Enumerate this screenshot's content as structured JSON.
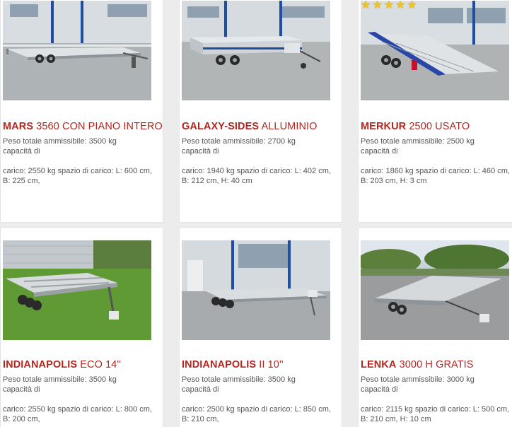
{
  "products": [
    {
      "brand": "MARS",
      "model": " 3560 CON PIANO INTERO",
      "weight_line": "Peso totale ammissibile: 3500 kg",
      "capacity_label": "capacità di",
      "cargo_line": "carico: 2550 kg spazio di carico: L: 600 cm, B: 225 cm,",
      "image_icon": "flatbed-trailer-photo"
    },
    {
      "brand": "GALAXY-SIDES",
      "model": " ALLUMINIO",
      "weight_line": "Peso totale ammissibile: 2700 kg",
      "capacity_label": "capacità di",
      "cargo_line": "carico: 1940 kg spazio di carico: L: 402 cm, B: 212 cm, H: 40 cm",
      "image_icon": "sided-trailer-photo"
    },
    {
      "brand": "MERKUR",
      "model": " 2500 USATO",
      "weight_line": "Peso totale ammissibile: 2500 kg",
      "capacity_label": "capacità di",
      "cargo_line": "carico: 1860 kg spazio di carico: L: 460 cm, B: 203 cm, H: 3 cm",
      "image_icon": "car-transporter-photo",
      "rating": 5
    },
    {
      "brand": "INDIANAPOLIS",
      "model": " ECO 14''",
      "weight_line": "Peso totale ammissibile: 3500 kg",
      "capacity_label": "capacità di",
      "cargo_line": "carico: 2550 kg spazio di carico: L: 800 cm, B: 200 cm,",
      "image_icon": "tri-axle-trailer-photo"
    },
    {
      "brand": "INDIANAPOLIS",
      "model": " II 10''",
      "weight_line": "Peso totale ammissibile: 3500 kg",
      "capacity_label": "capacità di",
      "cargo_line": "carico: 2500 kg spazio di carico: L: 850 cm, B: 210 cm,",
      "image_icon": "long-flatbed-trailer-photo"
    },
    {
      "brand": "LENKA",
      "model": " 3000 H GRATIS",
      "weight_line": "Peso totale ammissibile: 3000 kg",
      "capacity_label": "capacità di",
      "cargo_line": "carico: 2115 kg spazio di carico: L: 500 cm, B: 210 cm, H: 10 cm",
      "image_icon": "tilting-trailer-photo"
    }
  ],
  "colors": {
    "title": "#b3261e",
    "text": "#555555",
    "background": "#ececec",
    "star": "#f0c419"
  }
}
